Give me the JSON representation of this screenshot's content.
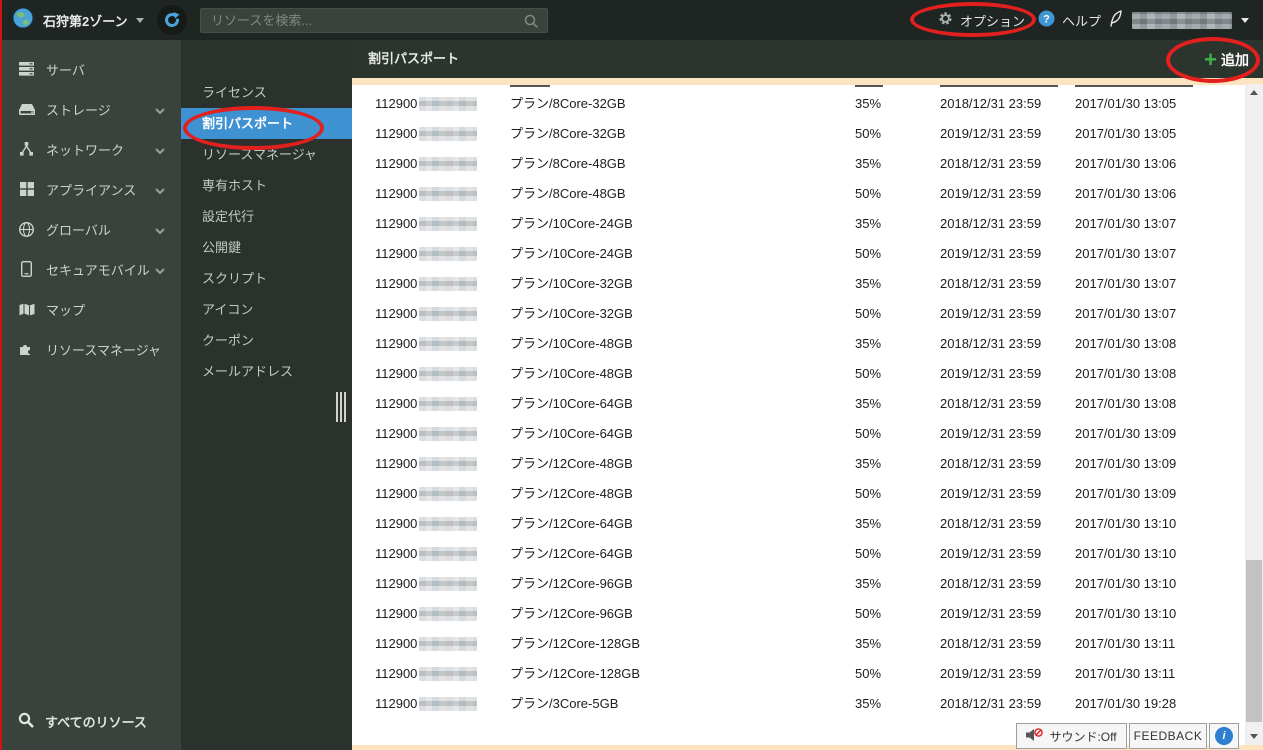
{
  "colors": {
    "topbar_bg": "#1f2522",
    "sidebar_bg": "#3a423c",
    "subsidebar_bg": "#2b322d",
    "header_bg": "#2c342e",
    "active_item_blue": "#3f92d2",
    "accent_blue": "#429bd6",
    "add_green": "#41b04a",
    "annotation_red": "#e2201e",
    "cream_strip": "#fbe4bf"
  },
  "top_bar": {
    "zone_label": "石狩第2ゾーン",
    "search_placeholder": "リソースを検索...",
    "options_label": "オプション",
    "help_label": "ヘルプ"
  },
  "sidebar": {
    "items": [
      {
        "label": "サーバ",
        "expandable": false
      },
      {
        "label": "ストレージ",
        "expandable": true
      },
      {
        "label": "ネットワーク",
        "expandable": true
      },
      {
        "label": "アプライアンス",
        "expandable": true
      },
      {
        "label": "グローバル",
        "expandable": true
      },
      {
        "label": "セキュアモバイル",
        "expandable": true
      },
      {
        "label": "マップ",
        "expandable": false
      },
      {
        "label": "リソースマネージャ",
        "expandable": false
      }
    ],
    "footer_label": "すべてのリソース"
  },
  "subsidebar": {
    "active_label": "割引パスポート",
    "items": [
      {
        "label": "ライセンス"
      },
      {
        "label": "割引パスポート"
      },
      {
        "label": "リソースマネージャ"
      },
      {
        "label": "専有ホスト"
      },
      {
        "label": "設定代行"
      },
      {
        "label": "公開鍵"
      },
      {
        "label": "スクリプト"
      },
      {
        "label": "アイコン"
      },
      {
        "label": "クーポン"
      },
      {
        "label": "メールアドレス"
      }
    ]
  },
  "content": {
    "title": "割引パスポート",
    "add_button_label": "追加",
    "table": {
      "rows": [
        {
          "id": "112900",
          "plan": "プラン/8Core-32GB",
          "rate": "35%",
          "expire": "2018/12/31 23:59",
          "created": "2017/01/30 13:05"
        },
        {
          "id": "112900",
          "plan": "プラン/8Core-32GB",
          "rate": "50%",
          "expire": "2019/12/31 23:59",
          "created": "2017/01/30 13:05"
        },
        {
          "id": "112900",
          "plan": "プラン/8Core-48GB",
          "rate": "35%",
          "expire": "2018/12/31 23:59",
          "created": "2017/01/30 13:06"
        },
        {
          "id": "112900",
          "plan": "プラン/8Core-48GB",
          "rate": "50%",
          "expire": "2019/12/31 23:59",
          "created": "2017/01/30 13:06"
        },
        {
          "id": "112900",
          "plan": "プラン/10Core-24GB",
          "rate": "35%",
          "expire": "2018/12/31 23:59",
          "created": "2017/01/30 13:07"
        },
        {
          "id": "112900",
          "plan": "プラン/10Core-24GB",
          "rate": "50%",
          "expire": "2019/12/31 23:59",
          "created": "2017/01/30 13:07"
        },
        {
          "id": "112900",
          "plan": "プラン/10Core-32GB",
          "rate": "35%",
          "expire": "2018/12/31 23:59",
          "created": "2017/01/30 13:07"
        },
        {
          "id": "112900",
          "plan": "プラン/10Core-32GB",
          "rate": "50%",
          "expire": "2019/12/31 23:59",
          "created": "2017/01/30 13:07"
        },
        {
          "id": "112900",
          "plan": "プラン/10Core-48GB",
          "rate": "35%",
          "expire": "2018/12/31 23:59",
          "created": "2017/01/30 13:08"
        },
        {
          "id": "112900",
          "plan": "プラン/10Core-48GB",
          "rate": "50%",
          "expire": "2019/12/31 23:59",
          "created": "2017/01/30 13:08"
        },
        {
          "id": "112900",
          "plan": "プラン/10Core-64GB",
          "rate": "35%",
          "expire": "2018/12/31 23:59",
          "created": "2017/01/30 13:08"
        },
        {
          "id": "112900",
          "plan": "プラン/10Core-64GB",
          "rate": "50%",
          "expire": "2019/12/31 23:59",
          "created": "2017/01/30 13:09"
        },
        {
          "id": "112900",
          "plan": "プラン/12Core-48GB",
          "rate": "35%",
          "expire": "2018/12/31 23:59",
          "created": "2017/01/30 13:09"
        },
        {
          "id": "112900",
          "plan": "プラン/12Core-48GB",
          "rate": "50%",
          "expire": "2019/12/31 23:59",
          "created": "2017/01/30 13:09"
        },
        {
          "id": "112900",
          "plan": "プラン/12Core-64GB",
          "rate": "35%",
          "expire": "2018/12/31 23:59",
          "created": "2017/01/30 13:10"
        },
        {
          "id": "112900",
          "plan": "プラン/12Core-64GB",
          "rate": "50%",
          "expire": "2019/12/31 23:59",
          "created": "2017/01/30 13:10"
        },
        {
          "id": "112900",
          "plan": "プラン/12Core-96GB",
          "rate": "35%",
          "expire": "2018/12/31 23:59",
          "created": "2017/01/30 13:10"
        },
        {
          "id": "112900",
          "plan": "プラン/12Core-96GB",
          "rate": "50%",
          "expire": "2019/12/31 23:59",
          "created": "2017/01/30 13:10"
        },
        {
          "id": "112900",
          "plan": "プラン/12Core-128GB",
          "rate": "35%",
          "expire": "2018/12/31 23:59",
          "created": "2017/01/30 13:11"
        },
        {
          "id": "112900",
          "plan": "プラン/12Core-128GB",
          "rate": "50%",
          "expire": "2019/12/31 23:59",
          "created": "2017/01/30 13:11"
        },
        {
          "id": "112900",
          "plan": "プラン/3Core-5GB",
          "rate": "35%",
          "expire": "2018/12/31 23:59",
          "created": "2017/01/30 19:28"
        }
      ]
    }
  },
  "footer": {
    "sound_label": "サウンド:Off",
    "feedback_label": "FEEDBACK"
  }
}
